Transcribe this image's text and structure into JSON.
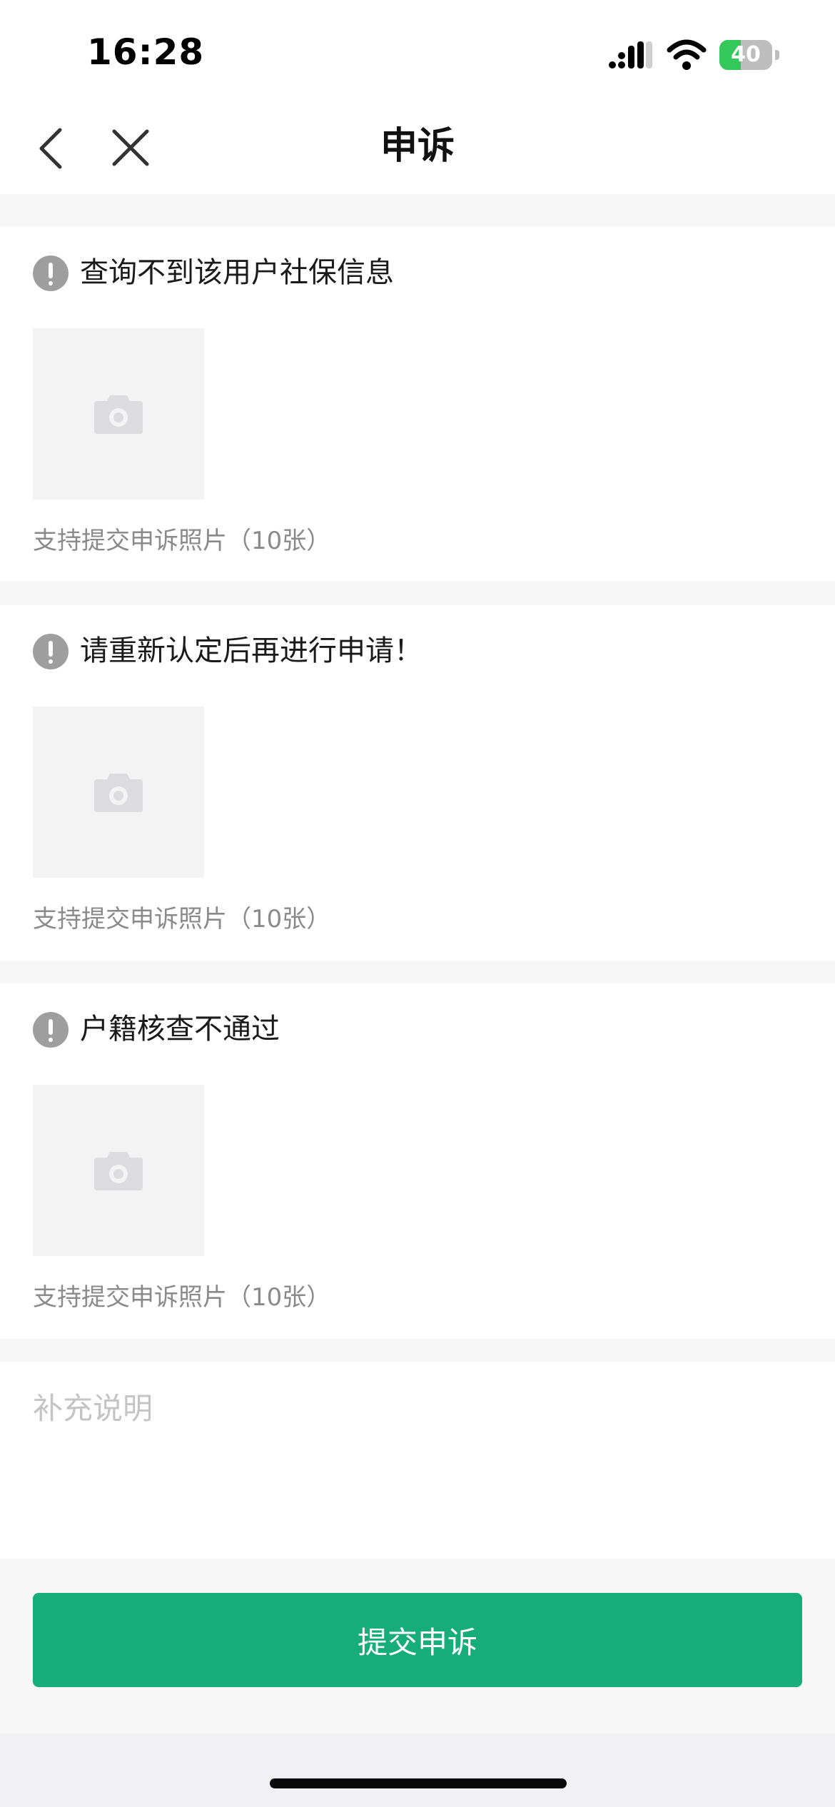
{
  "status_bar": {
    "time": "16:28",
    "battery_level": 40,
    "battery_label": "40",
    "signal_icon": "cellular-signal-icon",
    "wifi_icon": "wifi-icon"
  },
  "nav": {
    "title": "申诉",
    "back_icon": "chevron-left-icon",
    "close_icon": "close-icon"
  },
  "sections": [
    {
      "title": "查询不到该用户社保信息",
      "hint": "支持提交申诉照片（10张）",
      "warning_icon": "exclamation-circle-icon",
      "upload_icon": "camera-icon"
    },
    {
      "title": "请重新认定后再进行申请！",
      "hint": "支持提交申诉照片（10张）",
      "warning_icon": "exclamation-circle-icon",
      "upload_icon": "camera-icon"
    },
    {
      "title": "户籍核查不通过",
      "hint": "支持提交申诉照片（10张）",
      "warning_icon": "exclamation-circle-icon",
      "upload_icon": "camera-icon"
    }
  ],
  "note": {
    "placeholder": "补充说明",
    "value": ""
  },
  "footer": {
    "submit_label": "提交申诉"
  },
  "colors": {
    "accent": "#16ad7a",
    "warning_icon": "#9e9e9e",
    "hint_text": "#8a8a8a",
    "placeholder": "#c4c4c4",
    "battery_fill": "#34c759"
  }
}
